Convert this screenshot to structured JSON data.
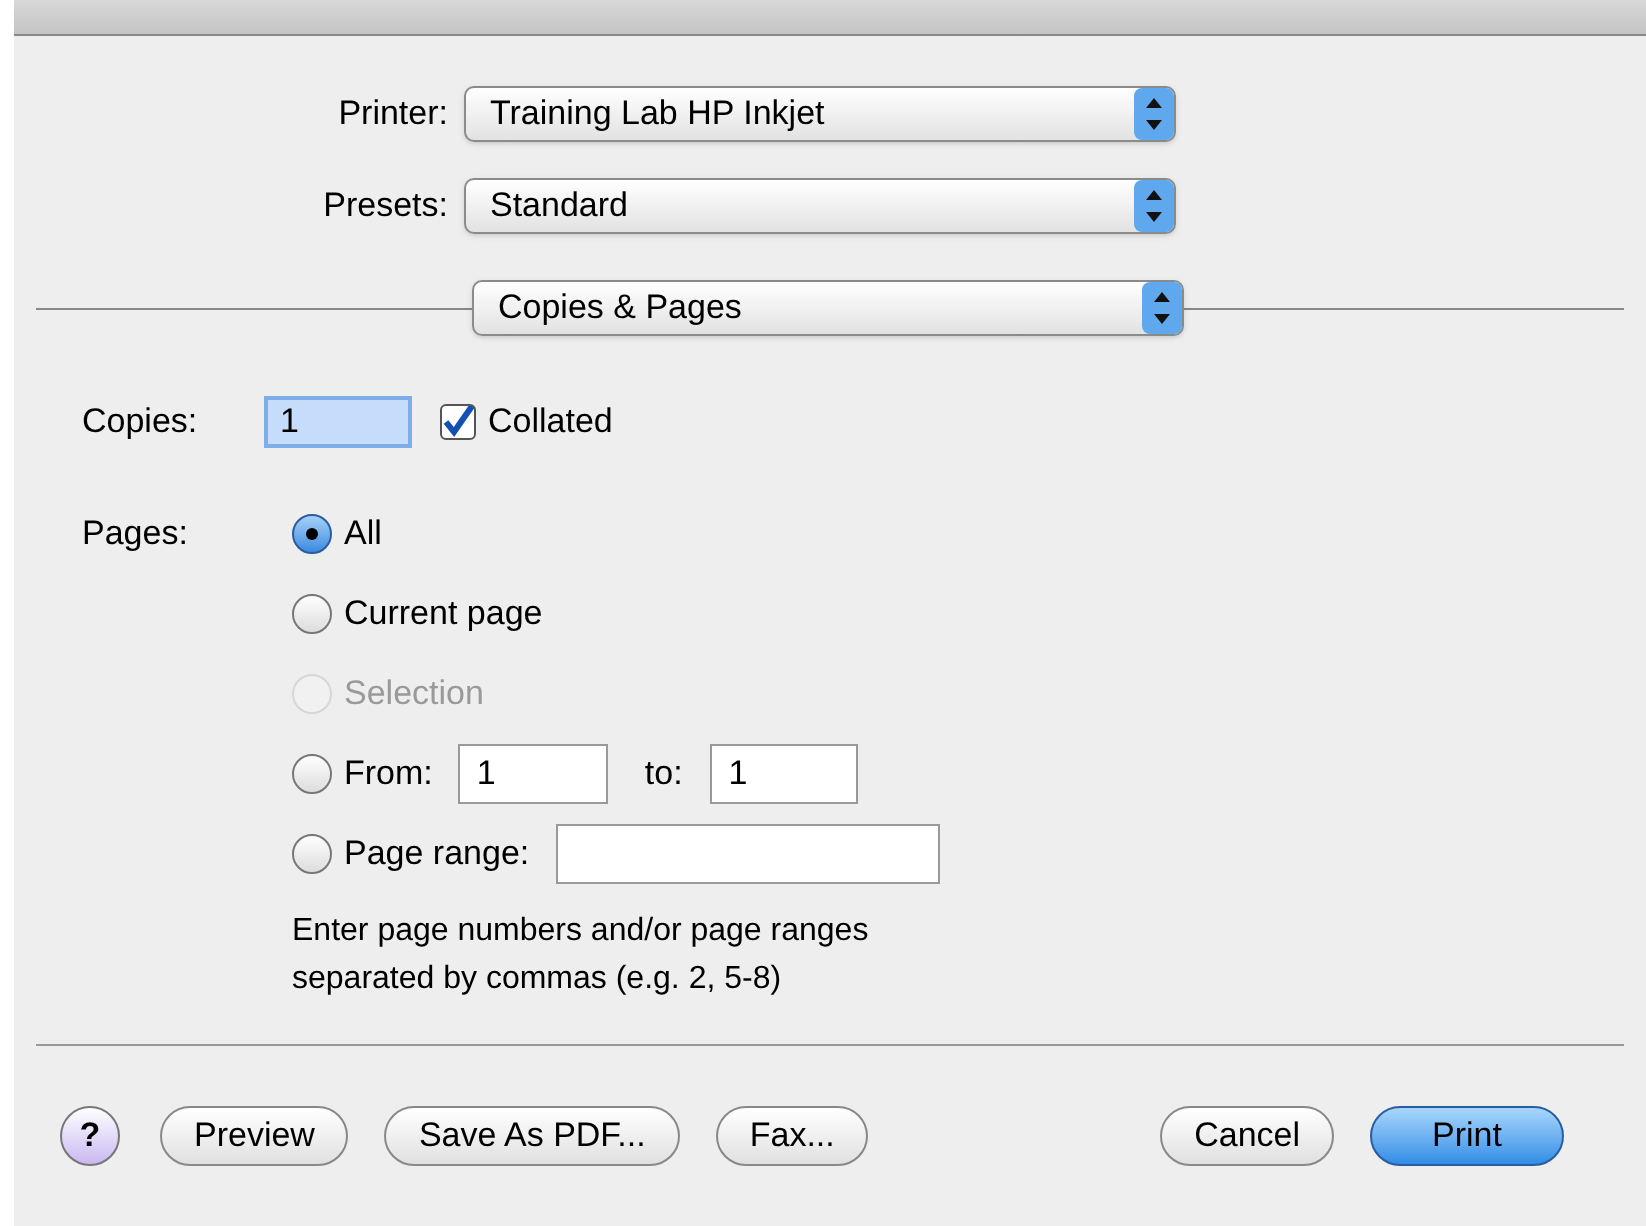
{
  "printer": {
    "label": "Printer:",
    "value": "Training Lab HP Inkjet"
  },
  "presets": {
    "label": "Presets:",
    "value": "Standard"
  },
  "panel_menu": {
    "value": "Copies & Pages"
  },
  "copies": {
    "label": "Copies:",
    "value": "1"
  },
  "collated": {
    "label": "Collated",
    "checked": true
  },
  "pages": {
    "label": "Pages:",
    "options": [
      {
        "kind": "plain",
        "label": "All",
        "selected": true,
        "disabled": false
      },
      {
        "kind": "plain",
        "label": "Current page",
        "selected": false,
        "disabled": false
      },
      {
        "kind": "plain",
        "label": "Selection",
        "selected": false,
        "disabled": true
      },
      {
        "kind": "range",
        "label": "From:",
        "selected": false,
        "disabled": false,
        "from_value": "1",
        "to_label": "to:",
        "to_value": "1"
      },
      {
        "kind": "field",
        "label": "Page range:",
        "selected": false,
        "disabled": false
      }
    ],
    "hint": "Enter page numbers and/or page ranges separated by commas (e.g. 2, 5-8)"
  },
  "help": {
    "label": "?"
  },
  "left_buttons": [
    {
      "label": "Preview",
      "default": false
    },
    {
      "label": "Save As PDF...",
      "default": false
    },
    {
      "label": "Fax...",
      "default": false
    }
  ],
  "right_buttons": [
    {
      "label": "Cancel",
      "default": false
    },
    {
      "label": "Print",
      "default": true
    }
  ]
}
